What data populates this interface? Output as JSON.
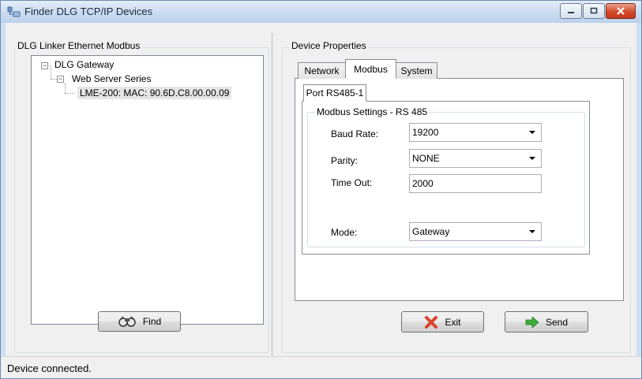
{
  "window": {
    "title": "Finder DLG TCP/IP Devices"
  },
  "left_panel": {
    "group_label": "DLG Linker Ethernet Modbus",
    "tree": [
      {
        "label": "DLG Gateway",
        "expanded": true
      },
      {
        "label": "Web Server Series",
        "expanded": true
      },
      {
        "label": "LME-200: MAC: 90.6D.C8.00.00.09",
        "selected": true
      }
    ],
    "find_button": "Find"
  },
  "right_panel": {
    "group_label": "Device Properties",
    "tabs": [
      "Network",
      "Modbus",
      "System"
    ],
    "active_tab": "Modbus",
    "subtab": "Port RS485-1",
    "modbus_group_label": "Modbus Settings - RS 485",
    "baud_rate": {
      "label": "Baud Rate:",
      "value": "19200"
    },
    "parity": {
      "label": "Parity:",
      "value": "NONE"
    },
    "time_out": {
      "label": "Time Out:",
      "value": "2000"
    },
    "mode": {
      "label": "Mode:",
      "value": "Gateway"
    },
    "exit_button": "Exit",
    "send_button": "Send"
  },
  "status": {
    "text": "Device connected."
  },
  "colors": {
    "exit_icon": "#d7432a",
    "send_icon": "#3cae3c",
    "selection": "#e5e5e5"
  }
}
